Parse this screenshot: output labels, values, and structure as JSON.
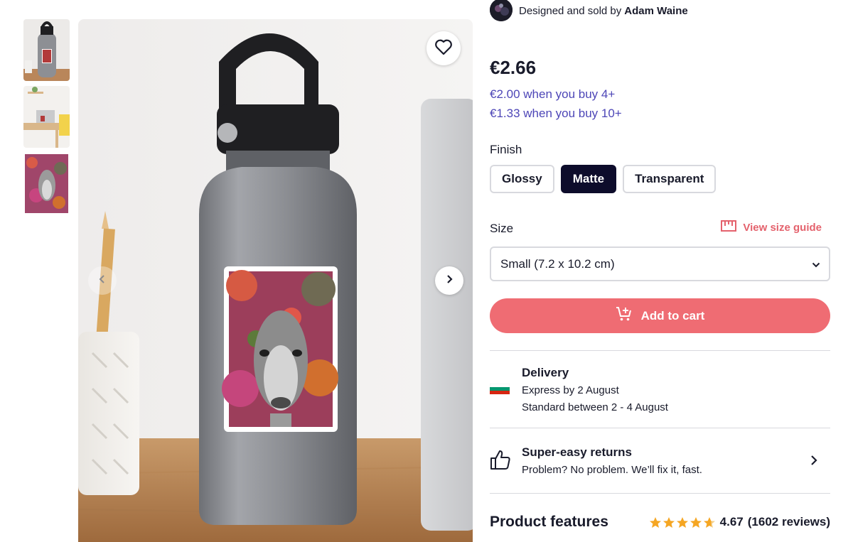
{
  "seller": {
    "prefix": "Designed and sold by",
    "name": "Adam Waine"
  },
  "price": {
    "main": "€2.66",
    "bulk": [
      "€2.00 when you buy 4+",
      "€1.33 when you buy 10+"
    ]
  },
  "finish": {
    "label": "Finish",
    "options": [
      "Glossy",
      "Matte",
      "Transparent"
    ],
    "selected": "Matte"
  },
  "size": {
    "label": "Size",
    "guide_label": "View size guide",
    "selected": "Small (7.2 x 10.2 cm)"
  },
  "cart": {
    "label": "Add to cart"
  },
  "delivery": {
    "title": "Delivery",
    "express": "Express by 2 August",
    "standard": "Standard between 2 - 4 August"
  },
  "returns": {
    "title": "Super-easy returns",
    "subtitle": "Problem? No problem. We’ll fix it, fast."
  },
  "features": {
    "title": "Product features",
    "rating": "4.67",
    "reviews": "(1602 reviews)",
    "stars": 4.67
  },
  "colors": {
    "accent": "#ef6c73",
    "bulk_price": "#4d46b7",
    "selected_option": "#0d0c2b"
  }
}
